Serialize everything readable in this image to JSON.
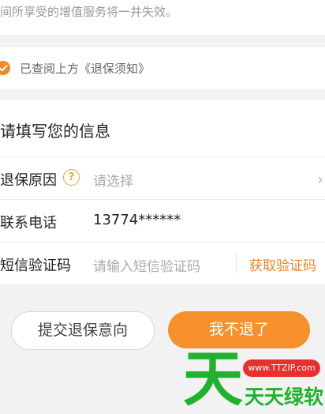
{
  "notice": {
    "text": "间所享受的增值服务将一并失效。"
  },
  "agreement": {
    "label": "已查阅上方《退保须知》",
    "checked": true
  },
  "form": {
    "title": "请填写您的信息",
    "reason": {
      "label": "退保原因",
      "help_icon": "question-circle-icon",
      "placeholder": "请选择",
      "arrow": "›"
    },
    "phone": {
      "label": "联系电话",
      "value": "13774******"
    },
    "sms": {
      "label": "短信验证码",
      "placeholder": "请输入短信验证码",
      "get_code": "获取验证码"
    }
  },
  "actions": {
    "submit": "提交退保意向",
    "stay": "我不退了"
  },
  "watermark": {
    "glyph": "天",
    "url": "www.TTZIP.com",
    "name": "天天绿软"
  },
  "colors": {
    "accent": "#f5902a",
    "watermark_green": "#1fb22c",
    "watermark_red": "#e9302e"
  }
}
